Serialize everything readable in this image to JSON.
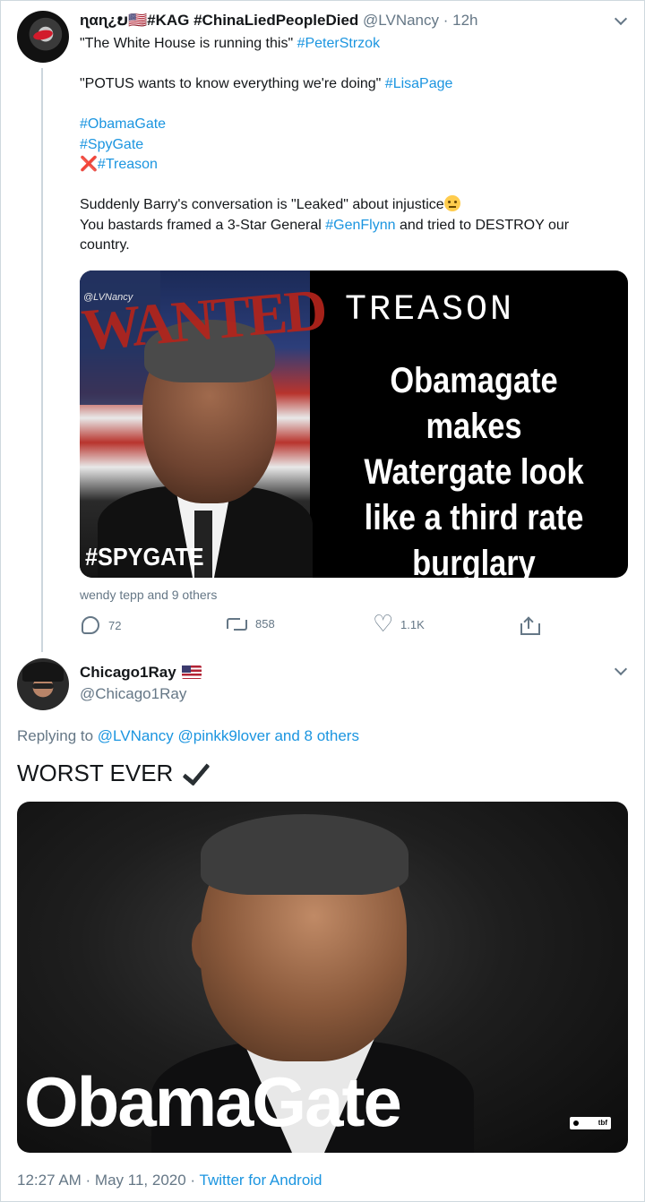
{
  "tweet1": {
    "name": "ɳαɳ¿ບ🇺🇸#KAG #ChinaLiedPeopleDied",
    "handle": "@LVNancy",
    "time": "12h",
    "lines": {
      "l1a": "\"The White House is running this\" ",
      "l1b": "#PeterStrzok",
      "l2a": "\"POTUS wants to know everything we're doing\" ",
      "l2b": "#LisaPage",
      "h1": "#ObamaGate",
      "h2": "#SpyGate",
      "h3x": "❌",
      "h3": "#Treason",
      "l4": "Suddenly Barry's conversation is \"Leaked\" about injustice",
      "l5a": "You bastards framed a 3-Star General ",
      "l5b": "#GenFlynn",
      "l5c": " and tried to DESTROY our",
      "l6": "country."
    },
    "image": {
      "watermark": "@LVNancy",
      "wanted": "WANTED",
      "treason": "TREASON",
      "body": [
        "Obamagate",
        "makes",
        "Watergate look",
        "like a third rate",
        "burglary"
      ],
      "corner_tag": "#SPYGATE"
    },
    "likers": "wendy tepp and 9 others",
    "stats": {
      "replies": "72",
      "retweets": "858",
      "likes": "1.1K"
    }
  },
  "tweet2": {
    "name": "Chicago1Ray",
    "handle": "@Chicago1Ray",
    "replying_prefix": "Replying to ",
    "replying_users": "@LVNancy @pinkk9lover and 8 others",
    "text": "WORST EVER",
    "image": {
      "title": "ObamaGate",
      "badge": "tbf"
    },
    "timestamp": "12:27 AM · May 11, 2020 · ",
    "source": "Twitter for Android"
  },
  "colors": {
    "link": "#1b95e0",
    "muted": "#657786",
    "text": "#14171a"
  }
}
